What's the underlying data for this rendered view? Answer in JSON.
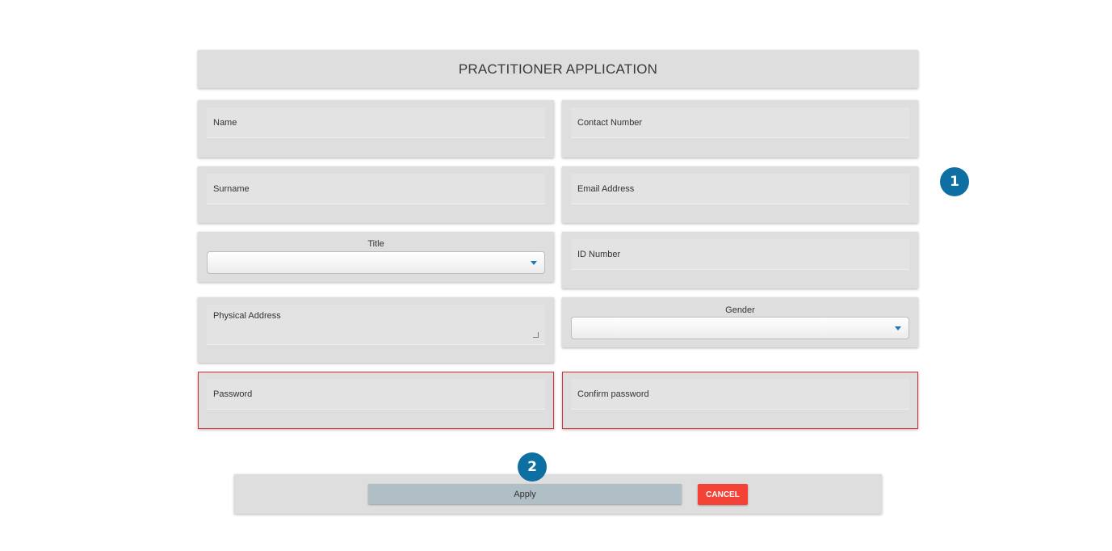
{
  "header": {
    "title": "PRACTITIONER APPLICATION"
  },
  "form": {
    "name_placeholder": "Name",
    "contact_number_placeholder": "Contact Number",
    "surname_placeholder": "Surname",
    "email_placeholder": "Email Address",
    "title_label": "Title",
    "title_value": "",
    "id_number_placeholder": "ID Number",
    "physical_address_placeholder": "Physical Address",
    "gender_label": "Gender",
    "gender_value": "",
    "password_placeholder": "Password",
    "confirm_password_placeholder": "Confirm password"
  },
  "actions": {
    "apply_label": "Apply",
    "cancel_label": "CANCEL"
  },
  "callouts": [
    "1",
    "2"
  ],
  "colors": {
    "card_bg": "#dedede",
    "error_border": "#d32f2f",
    "apply_bg": "#b0bec5",
    "cancel_bg": "#f44336",
    "badge_bg": "#0e6fa3"
  }
}
